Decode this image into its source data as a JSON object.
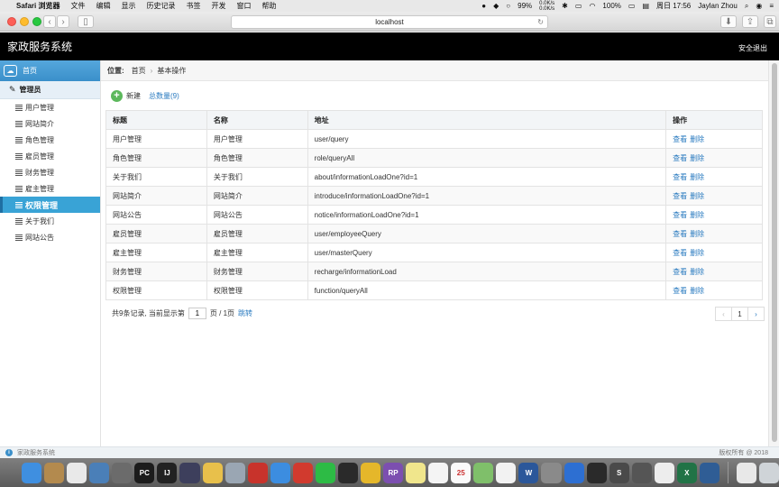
{
  "menubar": {
    "app_name": "Safari 浏览器",
    "menus": [
      "文件",
      "编辑",
      "显示",
      "历史记录",
      "书签",
      "开发",
      "窗口",
      "帮助"
    ],
    "battery": "99%",
    "net_up": "0.0K/s",
    "net_down": "0.0K/s",
    "battery2": "100%",
    "clock": "周日 17:56",
    "user": "Jaylan Zhou"
  },
  "browser": {
    "url": "localhost"
  },
  "header": {
    "title": "家政服务系统",
    "logout": "安全退出"
  },
  "sidebar": {
    "home": "首页",
    "section": "管理员",
    "items": [
      {
        "label": "用户管理",
        "active": false
      },
      {
        "label": "网站简介",
        "active": false
      },
      {
        "label": "角色管理",
        "active": false
      },
      {
        "label": "雇员管理",
        "active": false
      },
      {
        "label": "财务管理",
        "active": false
      },
      {
        "label": "雇主管理",
        "active": false
      },
      {
        "label": "权限管理",
        "active": true
      },
      {
        "label": "关于我们",
        "active": false
      },
      {
        "label": "网站公告",
        "active": false
      }
    ]
  },
  "breadcrumb": {
    "label": "位置:",
    "home": "首页",
    "current": "基本操作"
  },
  "actions": {
    "add": "新建",
    "count": "总数量(9)"
  },
  "table": {
    "headers": [
      "标题",
      "名称",
      "地址",
      "操作"
    ],
    "rows": [
      {
        "title": "用户管理",
        "name": "用户管理",
        "url": "user/query"
      },
      {
        "title": "角色管理",
        "name": "角色管理",
        "url": "role/queryAll"
      },
      {
        "title": "关于我们",
        "name": "关于我们",
        "url": "about/informationLoadOne?id=1"
      },
      {
        "title": "网站简介",
        "name": "网站简介",
        "url": "introduce/informationLoadOne?id=1"
      },
      {
        "title": "网站公告",
        "name": "网站公告",
        "url": "notice/informationLoadOne?id=1"
      },
      {
        "title": "雇员管理",
        "name": "雇员管理",
        "url": "user/employeeQuery"
      },
      {
        "title": "雇主管理",
        "name": "雇主管理",
        "url": "user/masterQuery"
      },
      {
        "title": "财务管理",
        "name": "财务管理",
        "url": "recharge/informationLoad"
      },
      {
        "title": "权限管理",
        "name": "权限管理",
        "url": "function/queryAll"
      }
    ],
    "view_label": "查看",
    "delete_label": "删除"
  },
  "pager": {
    "summary_prefix": "共9条记录, 当前显示第",
    "page_value": "1",
    "summary_suffix": "页 / 1页",
    "jump": "跳转",
    "current_page": "1",
    "prev": "‹",
    "next": "›"
  },
  "status": {
    "left": "家政服务系统",
    "right": "版权所有 @ 2018"
  },
  "dock": {
    "apps": [
      {
        "icon": "finder-icon",
        "color": "#3f8fe0",
        "text": ""
      },
      {
        "icon": "notes-icon",
        "color": "#b38a4e",
        "text": ""
      },
      {
        "icon": "photos-icon",
        "color": "#e9e9e9",
        "text": ""
      },
      {
        "icon": "preview-icon",
        "color": "#4a7fb8",
        "text": ""
      },
      {
        "icon": "launchpad-icon",
        "color": "#6b6b6b",
        "text": ""
      },
      {
        "icon": "pycharm-icon",
        "color": "#1c1c1c",
        "text": "PC"
      },
      {
        "icon": "intellij-icon",
        "color": "#222",
        "text": "IJ"
      },
      {
        "icon": "sublime-icon",
        "color": "#3d3f5c",
        "text": ""
      },
      {
        "icon": "yellow-app-icon",
        "color": "#e8c04b",
        "text": ""
      },
      {
        "icon": "disk-icon",
        "color": "#9aa6b3",
        "text": ""
      },
      {
        "icon": "redis-icon",
        "color": "#c8332b",
        "text": ""
      },
      {
        "icon": "safari-icon",
        "color": "#3c8de0",
        "text": ""
      },
      {
        "icon": "mail-icon",
        "color": "#d13a2e",
        "text": ""
      },
      {
        "icon": "wechat-icon",
        "color": "#2dbb45",
        "text": ""
      },
      {
        "icon": "qq-icon",
        "color": "#2a2a2a",
        "text": ""
      },
      {
        "icon": "chrome-icon",
        "color": "#e5b72a",
        "text": ""
      },
      {
        "icon": "axure-icon",
        "color": "#7c4fb0",
        "text": "RP"
      },
      {
        "icon": "stickies-icon",
        "color": "#f0e68c",
        "text": ""
      },
      {
        "icon": "reminders-icon",
        "color": "#f4f4f4",
        "text": ""
      },
      {
        "icon": "calendar-icon",
        "color": "#fafafa",
        "text": "25"
      },
      {
        "icon": "maps-icon",
        "color": "#7fbf6a",
        "text": ""
      },
      {
        "icon": "music-icon",
        "color": "#f2f2f2",
        "text": ""
      },
      {
        "icon": "word-icon",
        "color": "#2b579a",
        "text": "W"
      },
      {
        "icon": "system-prefs-icon",
        "color": "#8a8a8a",
        "text": ""
      },
      {
        "icon": "baidu-icon",
        "color": "#2d6fd2",
        "text": ""
      },
      {
        "icon": "qq2-icon",
        "color": "#2a2a2a",
        "text": ""
      },
      {
        "icon": "sublime2-icon",
        "color": "#4a4a4a",
        "text": "S"
      },
      {
        "icon": "scissor-icon",
        "color": "#555",
        "text": ""
      },
      {
        "icon": "paper-icon",
        "color": "#ededed",
        "text": ""
      },
      {
        "icon": "excel-icon",
        "color": "#217346",
        "text": "X"
      },
      {
        "icon": "globe-icon",
        "color": "#2f5d95",
        "text": ""
      },
      {
        "icon": "folder-icon",
        "color": "#e8e8e8",
        "text": ""
      },
      {
        "icon": "trash-icon",
        "color": "#cfd4d8",
        "text": ""
      }
    ]
  }
}
